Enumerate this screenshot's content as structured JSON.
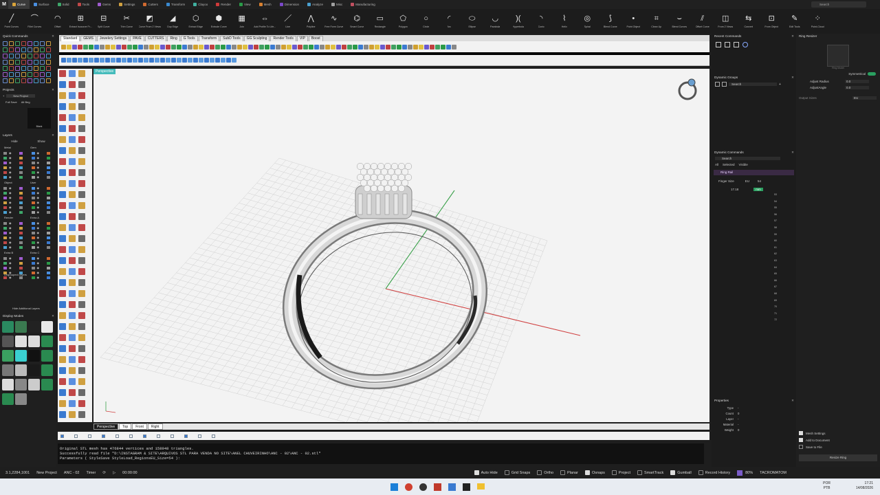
{
  "app": {
    "title": "TACROMATOM"
  },
  "topmenu": [
    {
      "label": "Curve",
      "active": true,
      "color": "#d9a43a"
    },
    {
      "label": "Surface",
      "active": false,
      "color": "#4a8fe0"
    },
    {
      "label": "Solid",
      "active": false,
      "color": "#3ea86a"
    },
    {
      "label": "Tools",
      "active": false,
      "color": "#c04848"
    },
    {
      "label": "Gems",
      "active": false,
      "color": "#a05cd0"
    },
    {
      "label": "Settings",
      "active": false,
      "color": "#d0a040"
    },
    {
      "label": "Cutters",
      "active": false,
      "color": "#d06a30"
    },
    {
      "label": "Transform",
      "active": false,
      "color": "#3a8ad0"
    },
    {
      "label": "Clayoo",
      "active": false,
      "color": "#40b0a0"
    },
    {
      "label": "Render",
      "active": false,
      "color": "#d03a3a"
    },
    {
      "label": "View",
      "active": false,
      "color": "#2a9a48"
    },
    {
      "label": "Mesh",
      "active": false,
      "color": "#d88030"
    },
    {
      "label": "Dimension",
      "active": false,
      "color": "#7a48c8"
    },
    {
      "label": "Analyze",
      "active": false,
      "color": "#4aa0d0"
    },
    {
      "label": "Misc",
      "active": false,
      "color": "#a0a0a0"
    },
    {
      "label": "Manufacturing",
      "active": false,
      "color": "#c05060"
    }
  ],
  "search": {
    "placeholder": "Search"
  },
  "toolbar": [
    {
      "label": "Point Curves",
      "glyph": "╱"
    },
    {
      "label": "Fillet Curves",
      "glyph": "⌒"
    },
    {
      "label": "Offset",
      "glyph": "◠"
    },
    {
      "label": "Extract Isocurve Fr...",
      "glyph": "⊞"
    },
    {
      "label": "Split Curve",
      "glyph": "⊟"
    },
    {
      "label": "Trim Curve",
      "glyph": "✂"
    },
    {
      "label": "Curve From 2 Views",
      "glyph": "◩"
    },
    {
      "label": "Dup Edge",
      "glyph": "◢"
    },
    {
      "label": "Extract Edge",
      "glyph": "⬡"
    },
    {
      "label": "Extrude Curve",
      "glyph": "⬢"
    },
    {
      "label": "Join",
      "glyph": "▦"
    },
    {
      "label": "Add Profile To Life...",
      "glyph": "⇔"
    },
    {
      "label": "Line",
      "glyph": "／"
    },
    {
      "label": "Polyline",
      "glyph": "⋀"
    },
    {
      "label": "Free Form Curve",
      "glyph": "∿"
    },
    {
      "label": "Smart Curve",
      "glyph": "⌬"
    },
    {
      "label": "Rectangle",
      "glyph": "▭"
    },
    {
      "label": "Polygon",
      "glyph": "⬠"
    },
    {
      "label": "Circle",
      "glyph": "○"
    },
    {
      "label": "Arc",
      "glyph": "◜"
    },
    {
      "label": "Ellipse",
      "glyph": "⬭"
    },
    {
      "label": "Parabola",
      "glyph": "◡"
    },
    {
      "label": "Hyperbola",
      "glyph": ")("
    },
    {
      "label": "Conic",
      "glyph": "◝"
    },
    {
      "label": "Helix",
      "glyph": "⌇"
    },
    {
      "label": "Spiral",
      "glyph": "◎"
    },
    {
      "label": "Blend Curve",
      "glyph": "⟆"
    },
    {
      "label": "Point Object",
      "glyph": "•"
    },
    {
      "label": "Clean Up",
      "glyph": "⌗"
    },
    {
      "label": "Blend Curves",
      "glyph": "⌣"
    },
    {
      "label": "Offset Curve",
      "glyph": "⫽"
    },
    {
      "label": "From 2 Views",
      "glyph": "◫"
    },
    {
      "label": "Convert",
      "glyph": "⇆"
    },
    {
      "label": "From Object",
      "glyph": "⊡"
    },
    {
      "label": "Edit Tools",
      "glyph": "✎"
    },
    {
      "label": "Point-Cloud",
      "glyph": "⁘"
    }
  ],
  "quick_commands": {
    "title": "Quick Commands"
  },
  "projects": {
    "title": "Projects",
    "new_project": "New Project",
    "tabs": [
      "Full Save",
      "Alt Beg"
    ],
    "thumb_label": "Blank"
  },
  "layers": {
    "title": "Layers",
    "hide": "Hide",
    "show": "Show",
    "groups": [
      "Metal",
      "Gem",
      "Object",
      "User",
      "Render",
      "Extra A",
      "Extra B",
      "Extra C"
    ],
    "ungrouped": "Ungrouped Layers",
    "hide_additional": "Hide Additional Layers"
  },
  "display_modes": {
    "title": "Display Modes"
  },
  "rhino_tabs": [
    "Standard",
    "GEMS",
    "Jewelery Settings",
    "PAVE",
    "CUTTERS",
    "Ring",
    "G Tools",
    "Transform",
    "SubD Tools",
    "GG Sculpting",
    "Render Tools",
    "VIP",
    "Boost"
  ],
  "viewport": {
    "name": "Perspective",
    "tabs": [
      "Perspective",
      "Top",
      "Front",
      "Right"
    ],
    "active_tab": "Perspective"
  },
  "command_history": [
    "Original STL mesh has 476844 vertices and 158948 triangles.",
    "Successfully read file \"D:\\INSTAGRAM & SITE\\ARQUIVOS STL PARA VENDA NO SITE\\ANEL CHUVEIRINHO\\ANC - 02\\ANC - 02.stl\"",
    "Parameters ( StyleSave StyleLoad_RegionsEU_Size=54 ):"
  ],
  "recent_commands": {
    "title": "Recent Commands"
  },
  "dynamic_groups": {
    "title": "Dynamic Groups",
    "search": "Search"
  },
  "dynamic_commands": {
    "title": "Dynamic Commands",
    "search": "Search",
    "filters": [
      "All",
      "Selected",
      "Visible"
    ],
    "group": "Ring Rail",
    "finger_size_label": "Finger Size",
    "region": "EU",
    "size_value": "54",
    "diameter": "17.18",
    "unit": "mm",
    "size_list": [
      "53",
      "54",
      "55",
      "56",
      "57",
      "58",
      "59",
      "60",
      "61",
      "62",
      "63",
      "64",
      "65",
      "66",
      "67",
      "68",
      "69",
      "70",
      "71",
      "72"
    ]
  },
  "properties": {
    "title": "Properties",
    "fields": [
      {
        "k": "Type",
        "v": "-"
      },
      {
        "k": "Count",
        "v": "0"
      },
      {
        "k": "Layer",
        "v": "-"
      },
      {
        "k": "Material",
        "v": "-"
      },
      {
        "k": "Weight",
        "v": "0"
      }
    ]
  },
  "ring_resizer": {
    "title": "Ring Resizer",
    "thumb_label": "Ring Model",
    "symmetrical": "Symmetrical",
    "adjust_radius": "Adjust Radius",
    "adjust_radius_val": "0.0",
    "adjust_angle": "AdjustAngle",
    "adjust_angle_val": "0.0",
    "output_sizes": "Output Sizes",
    "output_region": "EU",
    "options": [
      "Mesh Settings",
      "Add to Document",
      "Save to File"
    ],
    "button": "Resize Ring"
  },
  "status": {
    "coords": "3.1,2284,1001",
    "project": "New Project",
    "file": "ANC - 02",
    "timer": "Timer",
    "time": "00:00:00",
    "toggles": [
      {
        "label": "Auto Hide",
        "on": true
      },
      {
        "label": "Grid Snaps",
        "on": false
      },
      {
        "label": "Ortho",
        "on": false
      },
      {
        "label": "Planar",
        "on": false
      },
      {
        "label": "Osnaps",
        "on": true
      },
      {
        "label": "Project",
        "on": false
      },
      {
        "label": "SmartTrack",
        "on": false
      },
      {
        "label": "Gumball",
        "on": true
      },
      {
        "label": "Record History",
        "on": false
      }
    ],
    "zoom": "80%",
    "user": "TACROMATOM"
  },
  "taskbar": {
    "lang": "POR",
    "layout": "PTB",
    "time": "17:21",
    "date": "14/08/2026"
  }
}
